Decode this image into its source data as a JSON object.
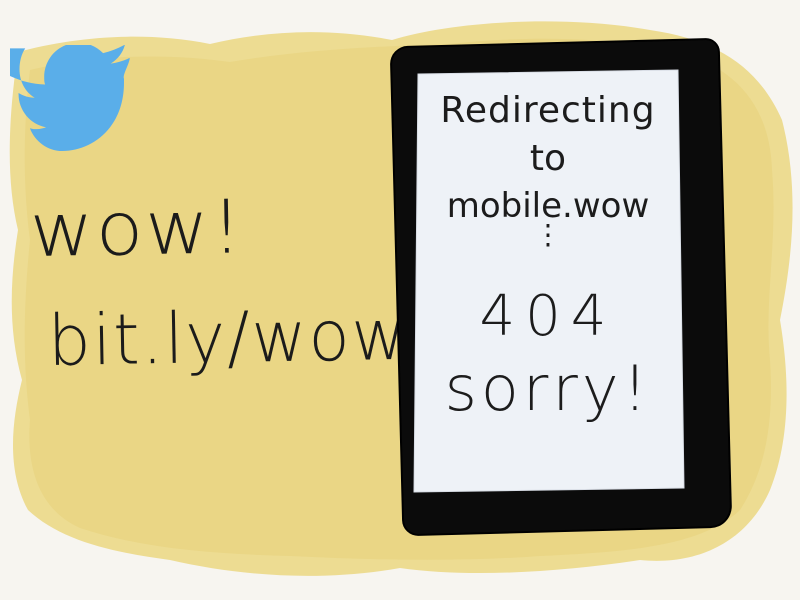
{
  "tweet": {
    "line1": "wow!",
    "line2": "bit.ly/wow"
  },
  "phone_screen": {
    "line1": "Redirecting",
    "line2": "to",
    "line3": "mobile.wow",
    "ellipsis": "⋮",
    "error_code": "404",
    "message": "sorry!"
  },
  "icons": {
    "bird": "twitter-bird-icon"
  },
  "colors": {
    "background_wash": "#ecd98a",
    "bird_blue": "#5aaee9",
    "phone_body": "#0b0b0b",
    "screen": "#eef2f7",
    "ink": "#1b1b1b"
  }
}
